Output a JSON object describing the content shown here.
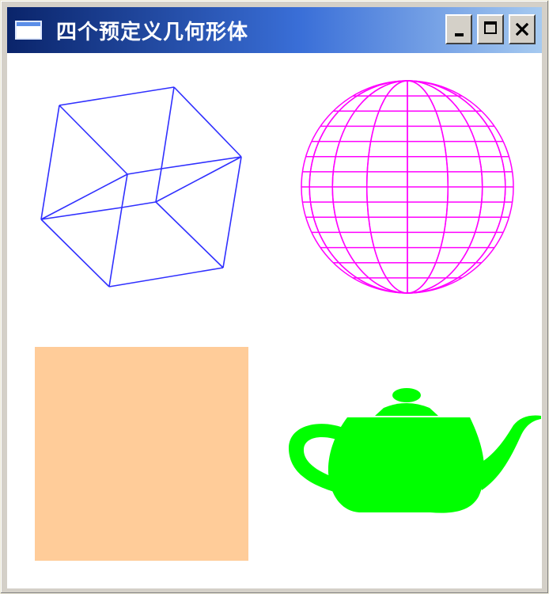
{
  "window": {
    "title": "四个预定义几何形体",
    "icon": "window-icon",
    "buttons": {
      "minimize": "minimize-icon",
      "maximize": "maximize-icon",
      "close": "close-icon"
    }
  },
  "scene": {
    "shapes": [
      {
        "name": "wire-cube",
        "style": "wireframe",
        "color": "#3030ff"
      },
      {
        "name": "wire-sphere",
        "style": "wireframe",
        "color": "#ff00ff"
      },
      {
        "name": "solid-square",
        "style": "solid",
        "color": "#ffcc99"
      },
      {
        "name": "solid-teapot",
        "style": "solid",
        "color": "#00ff00"
      }
    ]
  }
}
